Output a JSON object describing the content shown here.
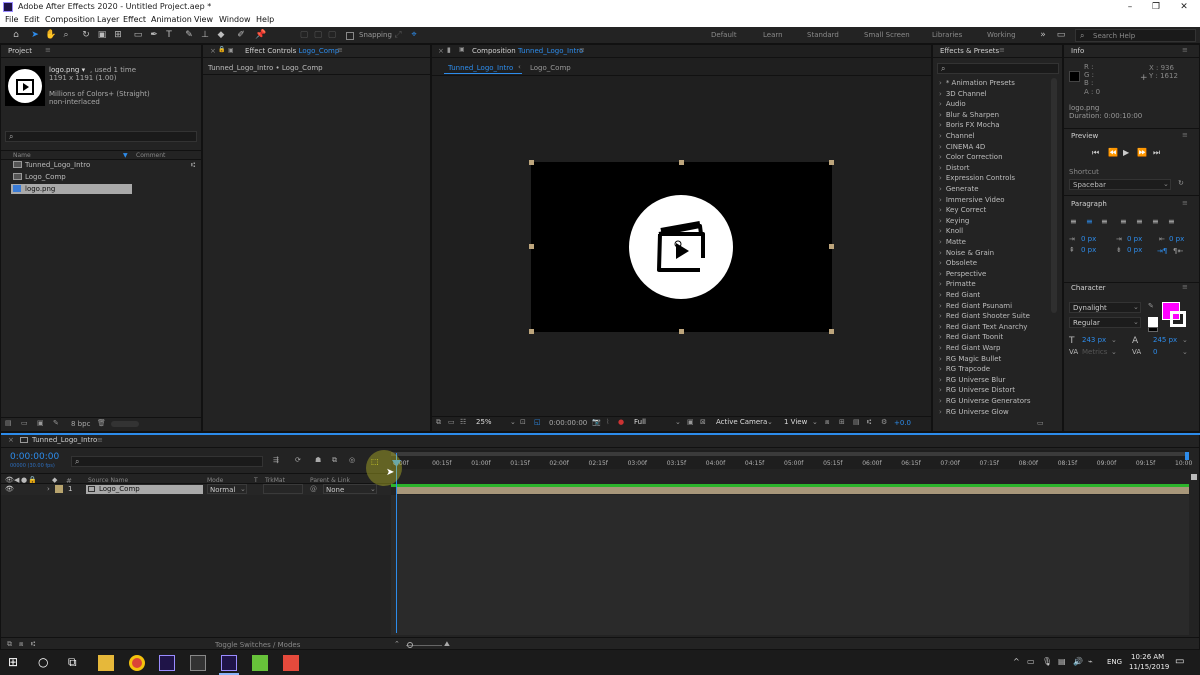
{
  "app": {
    "window_title": "Adobe After Effects 2020 - Untitled Project.aep *",
    "menu": [
      "File",
      "Edit",
      "Composition",
      "Layer",
      "Effect",
      "Animation",
      "View",
      "Window",
      "Help"
    ],
    "snapping_label": "Snapping",
    "workspaces": [
      "Default",
      "Learn",
      "Standard",
      "Small Screen",
      "Libraries",
      "Working"
    ],
    "search_help_placeholder": "Search Help",
    "window_controls": {
      "minimize": "–",
      "restore": "❐",
      "close": "✕"
    }
  },
  "project": {
    "tab": "Project",
    "asset_name": "logo.png ▾",
    "asset_used": ", used 1 time",
    "asset_size": "1191 x 1191 (1.00)",
    "asset_colors": "Millions of Colors+ (Straight)",
    "asset_interlace": "non-interlaced",
    "search_placeholder": "",
    "col_name": "Name",
    "col_comment": "Comment",
    "items": [
      "Tunned_Logo_Intro",
      "Logo_Comp",
      "logo.png"
    ],
    "bpc": "8 bpc"
  },
  "effect_controls": {
    "tab_prefix": "Effect Controls",
    "tab_comp": "Logo_Comp",
    "subtitle": "Tunned_Logo_Intro • Logo_Comp"
  },
  "composition": {
    "tab_prefix": "Composition",
    "tab_comp": "Tunned_Logo_Intro",
    "breadcrumb_active": "Tunned_Logo_Intro",
    "breadcrumb_sep": "‹",
    "breadcrumb_child": "Logo_Comp",
    "zoom": "25%",
    "timecode": "0:00:00:00",
    "resolution": "Full",
    "camera": "Active Camera",
    "view": "1 View",
    "exposure": "+0.0"
  },
  "effects": {
    "tab": "Effects & Presets",
    "search_placeholder": "",
    "categories": [
      "* Animation Presets",
      "3D Channel",
      "Audio",
      "Blur & Sharpen",
      "Boris FX Mocha",
      "Channel",
      "CINEMA 4D",
      "Color Correction",
      "Distort",
      "Expression Controls",
      "Generate",
      "Immersive Video",
      "Key Correct",
      "Keying",
      "Knoll",
      "Matte",
      "Noise & Grain",
      "Obsolete",
      "Perspective",
      "Primatte",
      "Red Giant",
      "Red Giant Psunami",
      "Red Giant Shooter Suite",
      "Red Giant Text Anarchy",
      "Red Giant Toonit",
      "Red Giant Warp",
      "RG Magic Bullet",
      "RG Trapcode",
      "RG Universe Blur",
      "RG Universe Distort",
      "RG Universe Generators",
      "RG Universe Glow"
    ]
  },
  "info": {
    "tab": "Info",
    "r": "R :",
    "g": "G :",
    "b": "B :",
    "a": "A : 0",
    "x": "X : 936",
    "y": "Y : 1612",
    "file": "logo.png",
    "duration": "Duration: 0:00:10:00"
  },
  "preview": {
    "tab": "Preview",
    "shortcut_label": "Shortcut",
    "shortcut_value": "Spacebar"
  },
  "paragraph": {
    "tab": "Paragraph",
    "indent_values": [
      "0 px",
      "0 px",
      "0 px",
      "0 px",
      "0 px"
    ]
  },
  "character": {
    "tab": "Character",
    "font": "Dynalight",
    "style": "Regular",
    "size": "243 px",
    "leading": "245 px",
    "kerning": "Metrics",
    "tracking": "0",
    "fill_color": "#ff00ff"
  },
  "timeline": {
    "tab": "Tunned_Logo_Intro",
    "timecode": "0:00:00:00",
    "timecode_sub": "00000 (30.00 fps)",
    "search_placeholder": "",
    "col_source": "Source Name",
    "col_mode": "Mode",
    "col_t": "T",
    "col_trkmat": "TrkMat",
    "col_parent": "Parent & Link",
    "layer_number": "1",
    "layer_name": "Logo_Comp",
    "layer_mode": "Normal",
    "layer_parent": "None",
    "ruler": [
      "0:00f",
      "00:15f",
      "01:00f",
      "01:15f",
      "02:00f",
      "02:15f",
      "03:00f",
      "03:15f",
      "04:00f",
      "04:15f",
      "05:00f",
      "05:15f",
      "06:00f",
      "06:15f",
      "07:00f",
      "07:15f",
      "08:00f",
      "08:15f",
      "09:00f",
      "09:15f",
      "10:00"
    ],
    "toggle_label": "Toggle Switches / Modes",
    "layer_bar_color": "#a8977a"
  },
  "taskbar": {
    "lang": "ENG",
    "time": "10:26 AM",
    "date": "11/15/2019"
  }
}
